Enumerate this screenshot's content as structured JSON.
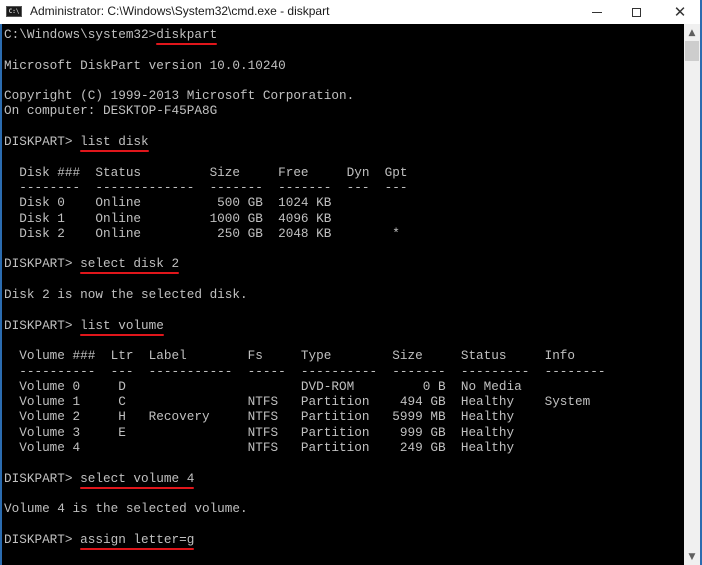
{
  "window": {
    "title": "Administrator: C:\\Windows\\System32\\cmd.exe - diskpart",
    "app_icon": "cmd-icon",
    "app_icon_text": "C:\\",
    "controls": {
      "minimize": "minimize-icon",
      "maximize": "maximize-icon",
      "close": "close-icon",
      "close_glyph": "✕"
    }
  },
  "scrollbar": {
    "up_glyph": "▲",
    "down_glyph": "▼"
  },
  "console": {
    "colors": {
      "background": "#000000",
      "text": "#c0c0c0",
      "underline": "#e0161b"
    },
    "lines": [
      {
        "prompt": "C:\\Windows\\system32>",
        "command": "diskpart"
      },
      {
        "text": ""
      },
      {
        "text": "Microsoft DiskPart version 10.0.10240"
      },
      {
        "text": ""
      },
      {
        "text": "Copyright (C) 1999-2013 Microsoft Corporation."
      },
      {
        "text": "On computer: DESKTOP-F45PA8G"
      },
      {
        "text": ""
      },
      {
        "prompt": "DISKPART> ",
        "command": "list disk"
      },
      {
        "text": ""
      },
      {
        "text": "  Disk ###  Status         Size     Free     Dyn  Gpt"
      },
      {
        "text": "  --------  -------------  -------  -------  ---  ---"
      },
      {
        "text": "  Disk 0    Online          500 GB  1024 KB"
      },
      {
        "text": "  Disk 1    Online         1000 GB  4096 KB"
      },
      {
        "text": "  Disk 2    Online          250 GB  2048 KB        *"
      },
      {
        "text": ""
      },
      {
        "prompt": "DISKPART> ",
        "command": "select disk 2"
      },
      {
        "text": ""
      },
      {
        "text": "Disk 2 is now the selected disk."
      },
      {
        "text": ""
      },
      {
        "prompt": "DISKPART> ",
        "command": "list volume"
      },
      {
        "text": ""
      },
      {
        "text": "  Volume ###  Ltr  Label        Fs     Type        Size     Status     Info"
      },
      {
        "text": "  ----------  ---  -----------  -----  ----------  -------  ---------  --------"
      },
      {
        "text": "  Volume 0     D                       DVD-ROM         0 B  No Media"
      },
      {
        "text": "  Volume 1     C                NTFS   Partition    494 GB  Healthy    System"
      },
      {
        "text": "  Volume 2     H   Recovery     NTFS   Partition   5999 MB  Healthy"
      },
      {
        "text": "  Volume 3     E                NTFS   Partition    999 GB  Healthy"
      },
      {
        "text": "  Volume 4                      NTFS   Partition    249 GB  Healthy"
      },
      {
        "text": ""
      },
      {
        "prompt": "DISKPART> ",
        "command": "select volume 4"
      },
      {
        "text": ""
      },
      {
        "text": "Volume 4 is the selected volume."
      },
      {
        "text": ""
      },
      {
        "prompt": "DISKPART> ",
        "command": "assign letter=g"
      }
    ]
  }
}
